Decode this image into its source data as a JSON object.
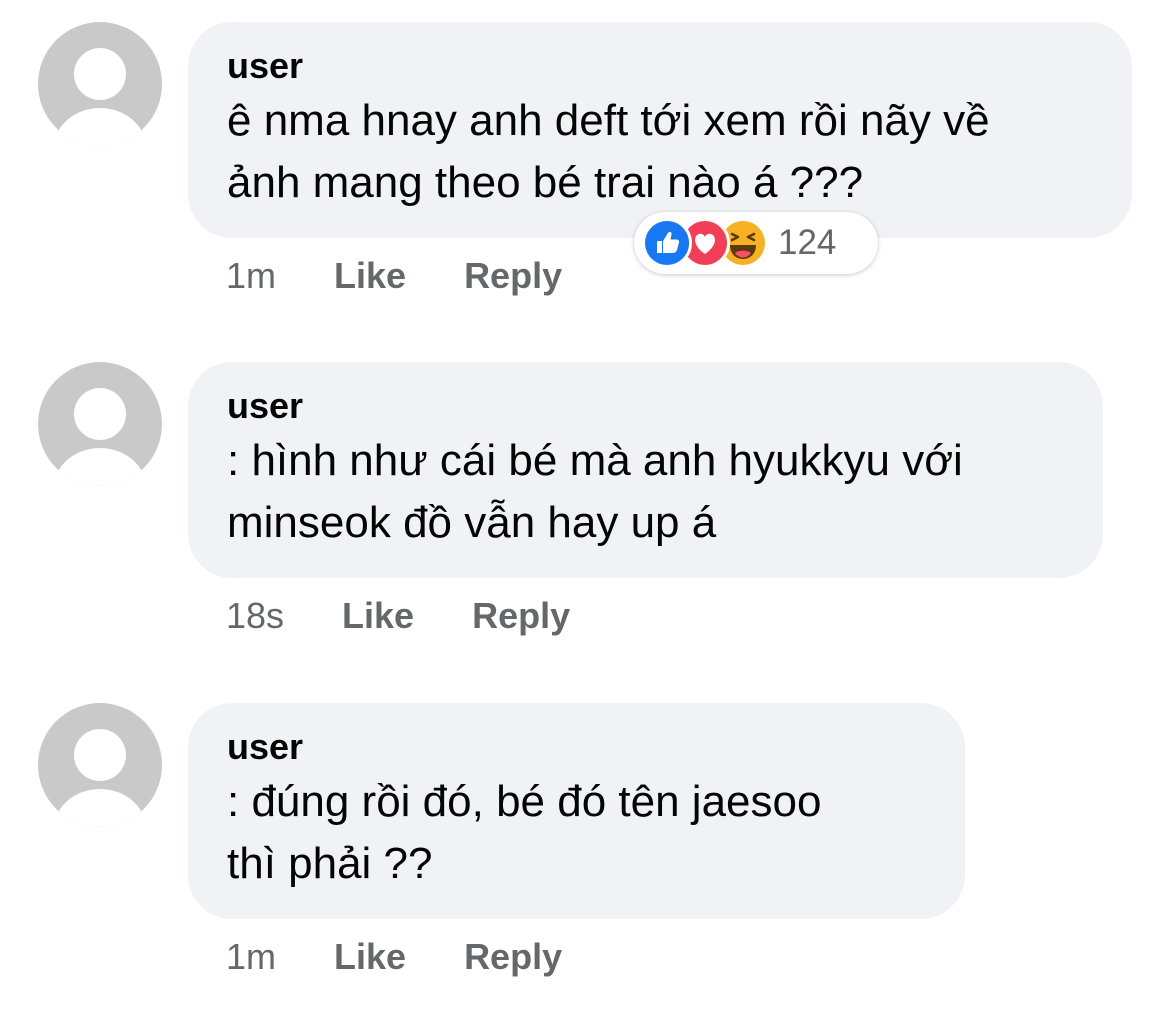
{
  "comments": [
    {
      "author": "user",
      "text_lines": [
        "ê nma hnay anh deft tới xem rồi nãy về",
        "ảnh mang theo bé trai nào á ???"
      ],
      "time": "1m",
      "like_label": "Like",
      "reply_label": "Reply",
      "reactions": {
        "icons": [
          "like-icon",
          "love-icon",
          "haha-icon"
        ],
        "count": "124"
      }
    },
    {
      "author": "user",
      "text_lines": [
        ": hình như cái bé mà anh hyukkyu với",
        "minseok đồ vẫn hay up á"
      ],
      "time": "18s",
      "like_label": "Like",
      "reply_label": "Reply"
    },
    {
      "author": "user",
      "text_lines": [
        ": đúng rồi đó, bé đó tên jaesoo",
        "thì phải ??"
      ],
      "time": "1m",
      "like_label": "Like",
      "reply_label": "Reply"
    }
  ],
  "colors": {
    "bubble": "#f0f2f5",
    "avatar": "#c9c9c9",
    "meta_text": "#65676b",
    "like_blue": "#1877f2",
    "love_red": "#f33e58",
    "haha_yellow": "#f7b125"
  }
}
